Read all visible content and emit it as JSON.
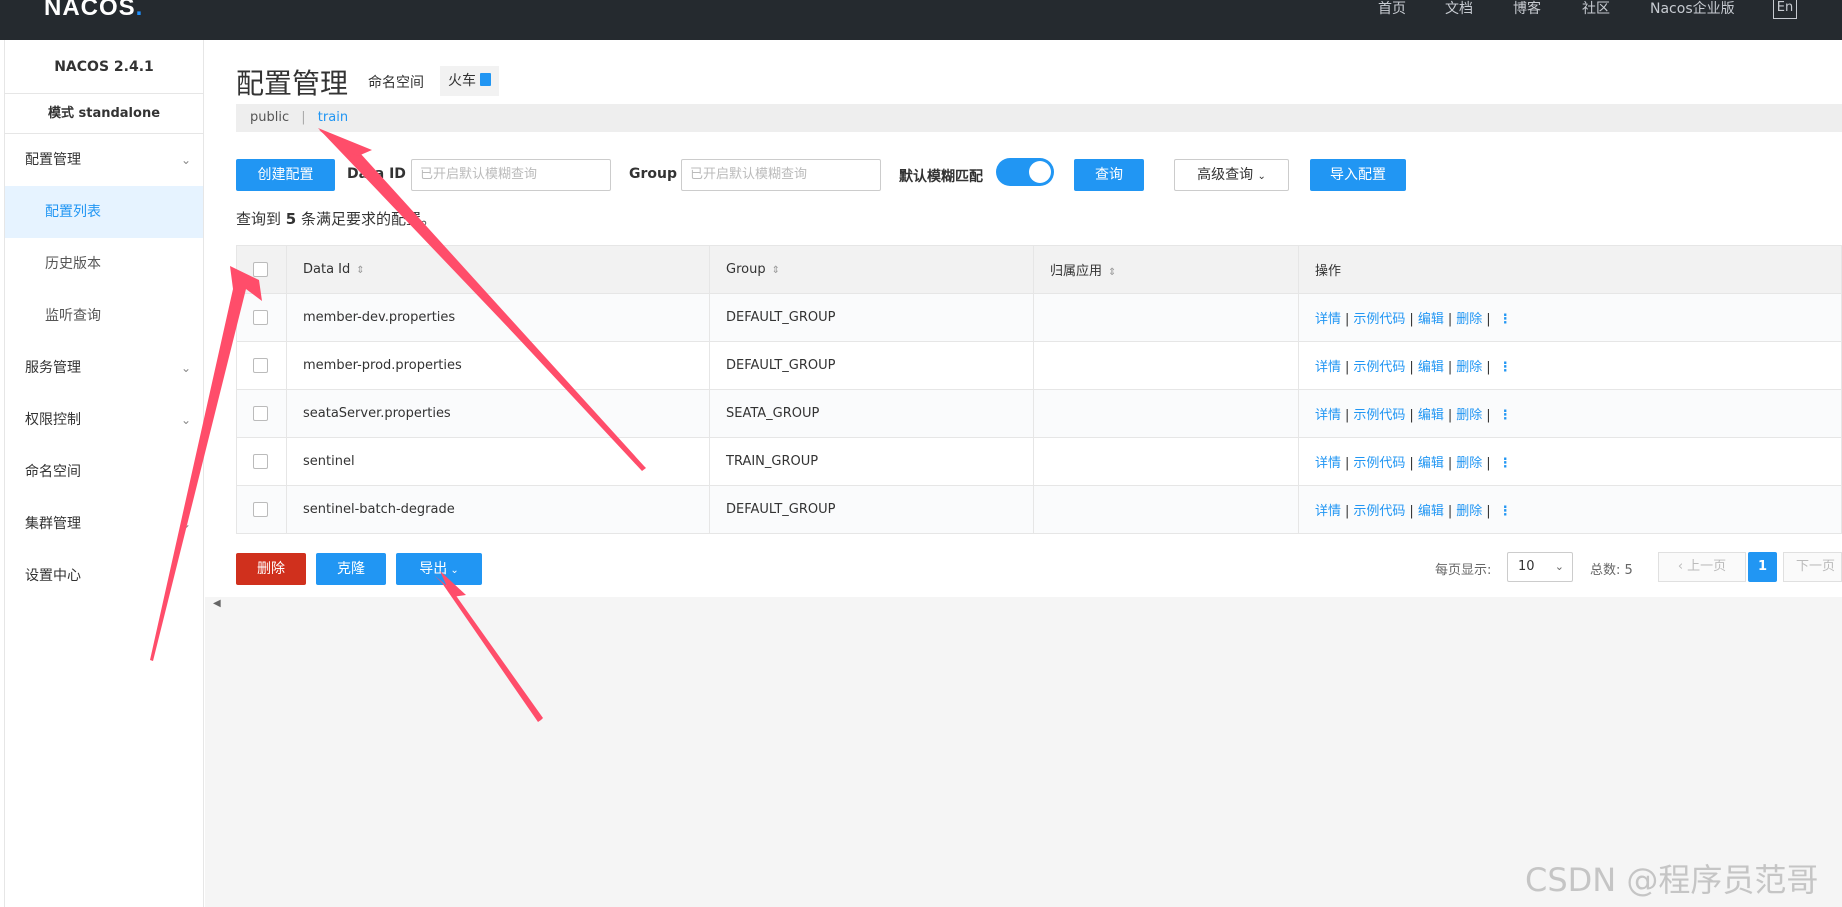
{
  "brand": {
    "logo_text": "NACOS",
    "logo_dot": "."
  },
  "topnav": {
    "items": [
      "首页",
      "文档",
      "博客",
      "社区",
      "Nacos企业版"
    ],
    "lang": "En"
  },
  "sidebar": {
    "version": "NACOS 2.4.1",
    "mode": "模式 standalone",
    "items": [
      {
        "label": "配置管理",
        "expandable": true
      },
      {
        "label": "配置列表"
      },
      {
        "label": "历史版本"
      },
      {
        "label": "监听查询"
      },
      {
        "label": "服务管理",
        "expandable": true
      },
      {
        "label": "权限控制",
        "expandable": true
      },
      {
        "label": "命名空间"
      },
      {
        "label": "集群管理",
        "expandable": true
      },
      {
        "label": "设置中心"
      }
    ]
  },
  "header": {
    "title": "配置管理",
    "namespace_label": "命名空间",
    "namespace_value": "火车"
  },
  "ns_bar": {
    "public": "public",
    "separator": "|",
    "current": "train"
  },
  "filters": {
    "create_button": "创建配置",
    "data_id_label": "Data ID",
    "data_id_placeholder": "已开启默认模糊查询",
    "group_label": "Group",
    "group_placeholder": "已开启默认模糊查询",
    "fuzzy_label": "默认模糊匹配",
    "fuzzy_enabled": true,
    "query_button": "查询",
    "advanced_button": "高级查询",
    "import_button": "导入配置"
  },
  "result": {
    "prefix": "查询到",
    "count": "5",
    "suffix": "条满足要求的配置。"
  },
  "table": {
    "columns": [
      "Data Id",
      "Group",
      "归属应用",
      "操作"
    ],
    "rows": [
      {
        "data_id": "member-dev.properties",
        "group": "DEFAULT_GROUP",
        "app": ""
      },
      {
        "data_id": "member-prod.properties",
        "group": "DEFAULT_GROUP",
        "app": ""
      },
      {
        "data_id": "seataServer.properties",
        "group": "SEATA_GROUP",
        "app": ""
      },
      {
        "data_id": "sentinel",
        "group": "TRAIN_GROUP",
        "app": ""
      },
      {
        "data_id": "sentinel-batch-degrade",
        "group": "DEFAULT_GROUP",
        "app": ""
      }
    ],
    "ops": {
      "detail": "详情",
      "sample": "示例代码",
      "edit": "编辑",
      "delete": "删除",
      "sep": "|"
    }
  },
  "bulk": {
    "delete": "删除",
    "clone": "克隆",
    "export": "导出"
  },
  "pager": {
    "per_page_label": "每页显示:",
    "per_page_value": "10",
    "total_label": "总数:",
    "total_value": "5",
    "prev": "上一页",
    "current": "1",
    "next": "下一页"
  },
  "watermark": "CSDN @程序员范哥",
  "annotation_color": "#ff4d6a"
}
